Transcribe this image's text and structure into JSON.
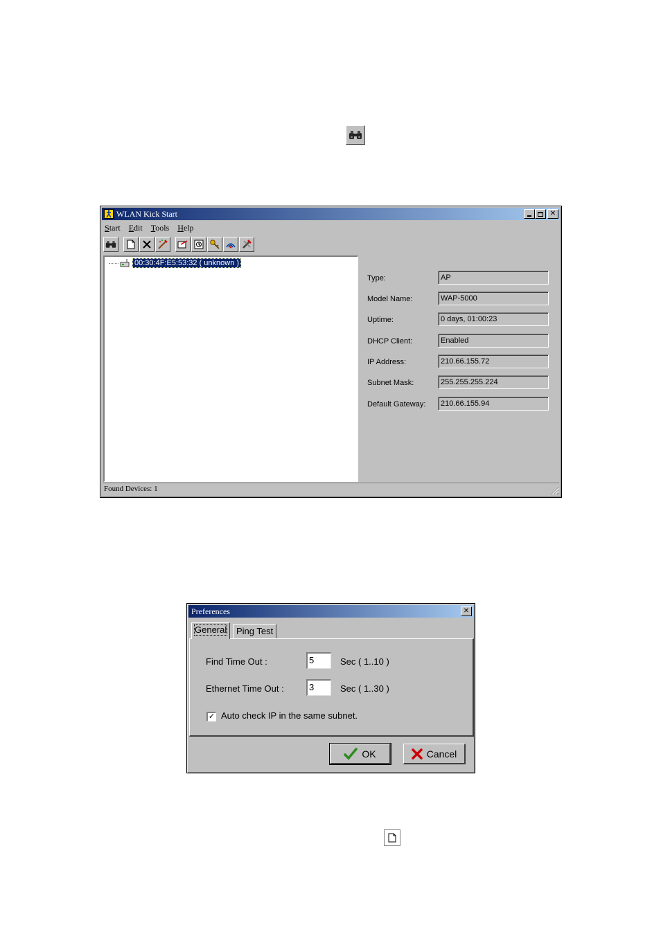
{
  "kickstart": {
    "title": "WLAN Kick Start",
    "menu": [
      "Start",
      "Edit",
      "Tools",
      "Help"
    ],
    "toolbar": {
      "icons": [
        "binoculars-icon",
        "new-document-icon",
        "delete-icon",
        "edit-wand-icon",
        "config-icon",
        "upgrade-icon",
        "key-icon",
        "wireless-icon",
        "tools-icon"
      ]
    },
    "tree": {
      "device": "00:30:4F:E5:53:32 ( unknown )"
    },
    "properties": [
      {
        "label": "Type:",
        "value": "AP"
      },
      {
        "label": "Model Name:",
        "value": "WAP-5000"
      },
      {
        "label": "Uptime:",
        "value": "0 days, 01:00:23"
      },
      {
        "label": "DHCP Client:",
        "value": "Enabled"
      },
      {
        "label": "IP Address:",
        "value": "210.66.155.72"
      },
      {
        "label": "Subnet Mask:",
        "value": "255.255.255.224"
      },
      {
        "label": "Default Gateway:",
        "value": "210.66.155.94"
      }
    ],
    "status": "Found Devices: 1"
  },
  "preferences": {
    "title": "Preferences",
    "tabs": [
      "General",
      "Ping Test"
    ],
    "find_timeout": {
      "label": "Find Time Out :",
      "value": "5",
      "range": "Sec ( 1..10 )"
    },
    "ethernet_timeout": {
      "label": "Ethernet Time Out :",
      "value": "3",
      "range": "Sec ( 1..30 )"
    },
    "auto_check": {
      "label": "Auto check IP in the same subnet.",
      "checked": true
    },
    "ok_label": "OK",
    "cancel_label": "Cancel"
  },
  "colors": {
    "titlebar_start": "#0a246a",
    "titlebar_end": "#a6caf0",
    "window_face": "#c0c0c0",
    "ok_check": "#2e8b20",
    "cancel_x": "#cc0000"
  }
}
